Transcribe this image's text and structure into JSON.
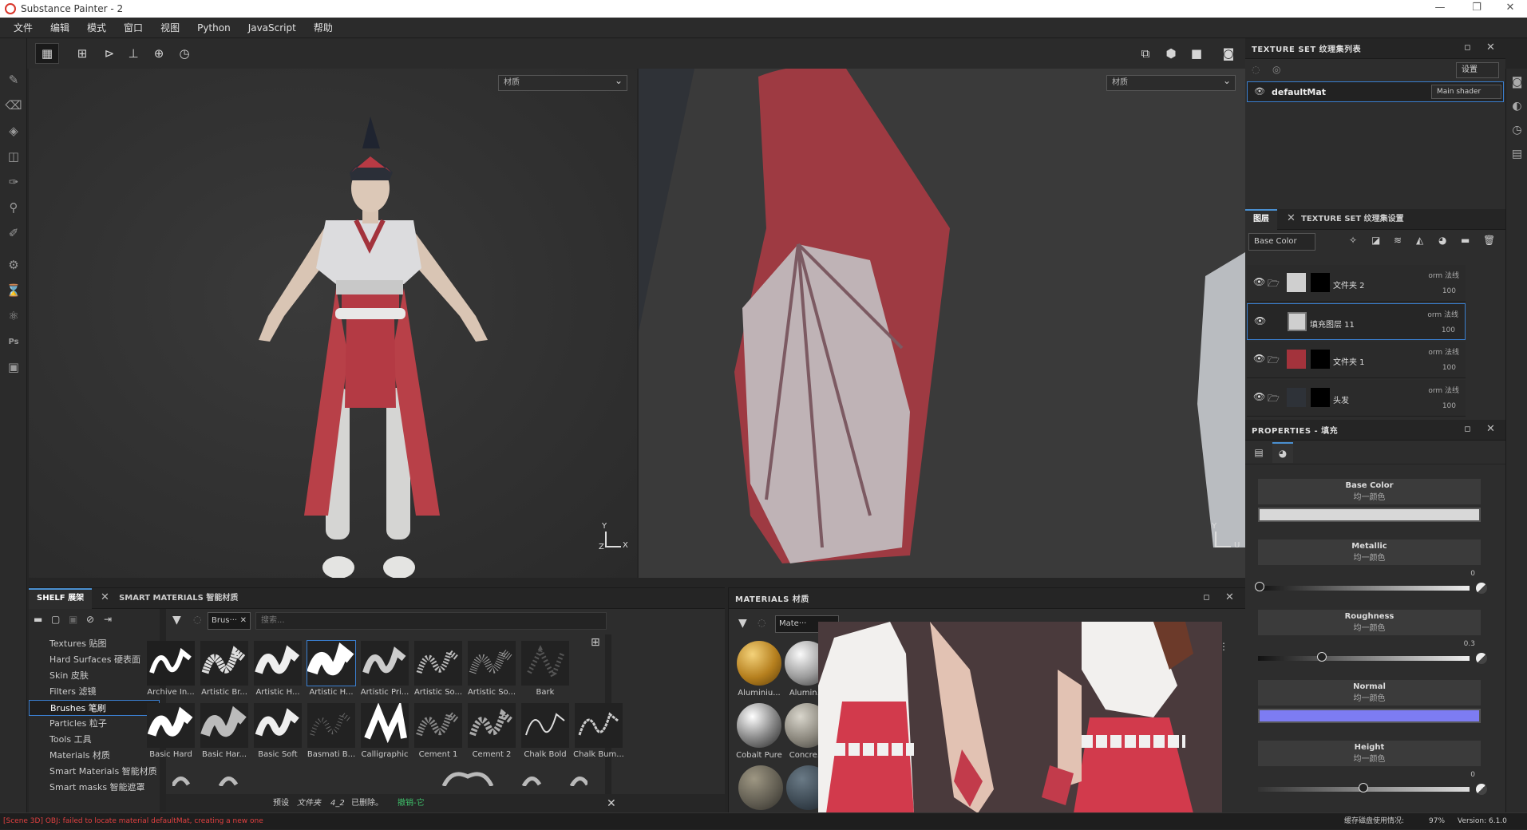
{
  "window": {
    "title": "Substance Painter - 2",
    "minimize": "—",
    "restore": "❐",
    "close": "✕"
  },
  "menu": [
    "文件",
    "编辑",
    "模式",
    "窗口",
    "视图",
    "Python",
    "JavaScript",
    "帮助"
  ],
  "viewport3d": {
    "material_dropdown": "材质",
    "axis_y": "Y",
    "axis_x": "X",
    "axis_z": "Z"
  },
  "viewport2d": {
    "material_dropdown": "材质",
    "axis_y": "Y",
    "axis_u": "U"
  },
  "texture_set_list": {
    "title": "TEXTURE SET 纹理集列表",
    "settings": "设置",
    "item_name": "defaultMat",
    "shader": "Main shader"
  },
  "layers": {
    "tab_layers": "图层",
    "tab_settings": "TEXTURE SET 纹理集设置",
    "channel": "Base Color",
    "rows": [
      {
        "name": "文件夹 2",
        "blend": "orm 法线",
        "opacity": "100"
      },
      {
        "name": "填充图层 11",
        "blend": "orm 法线",
        "opacity": "100"
      },
      {
        "name": "文件夹 1",
        "blend": "orm 法线",
        "opacity": "100"
      },
      {
        "name": "头发",
        "blend": "orm 法线",
        "opacity": "100"
      }
    ]
  },
  "properties": {
    "title": "PROPERTIES - 填充",
    "sections": [
      {
        "name": "Base Color",
        "sub": "均一颜色"
      },
      {
        "name": "Metallic",
        "sub": "均一颜色",
        "value": "0"
      },
      {
        "name": "Roughness",
        "sub": "均一颜色",
        "value": "0.3"
      },
      {
        "name": "Normal",
        "sub": "均一颜色"
      },
      {
        "name": "Height",
        "sub": "均一颜色",
        "value": "0"
      }
    ]
  },
  "shelf": {
    "tab_shelf": "SHELF 展架",
    "tab_smart": "SMART MATERIALS 智能材质",
    "filter_chip": "Brus···",
    "search_placeholder": "搜索...",
    "categories": [
      "Textures 贴图",
      "Hard Surfaces 硬表面",
      "Skin 皮肤",
      "Filters 滤镜",
      "Brushes 笔刷",
      "Particles 粒子",
      "Tools 工具",
      "Materials 材质",
      "Smart Materials 智能材质",
      "Smart masks 智能遮罩"
    ],
    "brushes_row1": [
      "Archive In...",
      "Artistic Br...",
      "Artistic H...",
      "Artistic H...",
      "Artistic Pri...",
      "Artistic So...",
      "Artistic So...",
      "Bark"
    ],
    "brushes_row2": [
      "Basic Hard",
      "Basic Har...",
      "Basic Soft",
      "Basmati B...",
      "Calligraphic",
      "Cement 1",
      "Cement 2",
      "Chalk Bold",
      "Chalk Bum..."
    ],
    "footer_preset": "预设",
    "footer_folder": "文件夹",
    "footer_name": "4_2",
    "footer_deleted": "已删除。",
    "footer_undo": "撤销-它"
  },
  "materials": {
    "title": "MATERIALS 材质",
    "filter_chip": "Mate···",
    "items": [
      "Aluminiu...",
      "Alumin...",
      "Cobalt Pure",
      "Concre..."
    ]
  },
  "status": {
    "error": "[Scene 3D] OBJ: failed to locate material defaultMat, creating a new one",
    "disk_label": "缓存磁盘使用情况:",
    "disk_value": "97%",
    "version": "Version: 6.1.0"
  }
}
